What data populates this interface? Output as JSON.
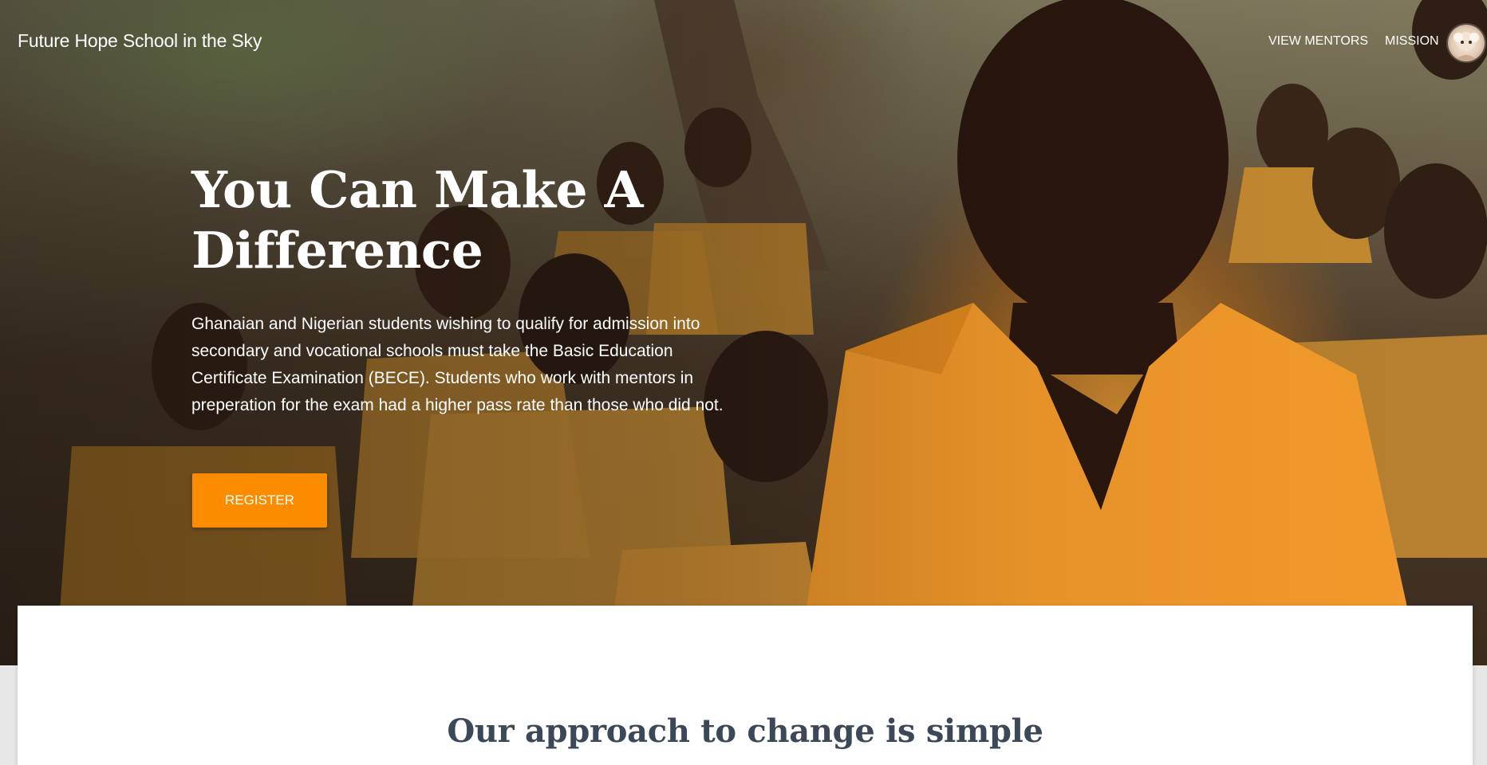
{
  "header": {
    "brand": "Future Hope School in the Sky",
    "nav": [
      {
        "label": "VIEW MENTORS"
      },
      {
        "label": "MISSION"
      }
    ],
    "avatar_icon": "user-avatar"
  },
  "hero": {
    "headline_line1": "You Can Make A",
    "headline_line2": "Difference",
    "description": "Ghanaian and Nigerian students wishing to qualify for admission into secondary and vocational schools must take the Basic Education Certificate Examination (BECE). Students who work with mentors in preperation for the exam had a higher pass rate than those who did not.",
    "register_label": "REGISTER"
  },
  "main": {
    "section_title": "Our approach to change is simple"
  },
  "colors": {
    "accent": "#fb8c00",
    "title": "#3c4858",
    "page_background": "#e6e6e6"
  }
}
